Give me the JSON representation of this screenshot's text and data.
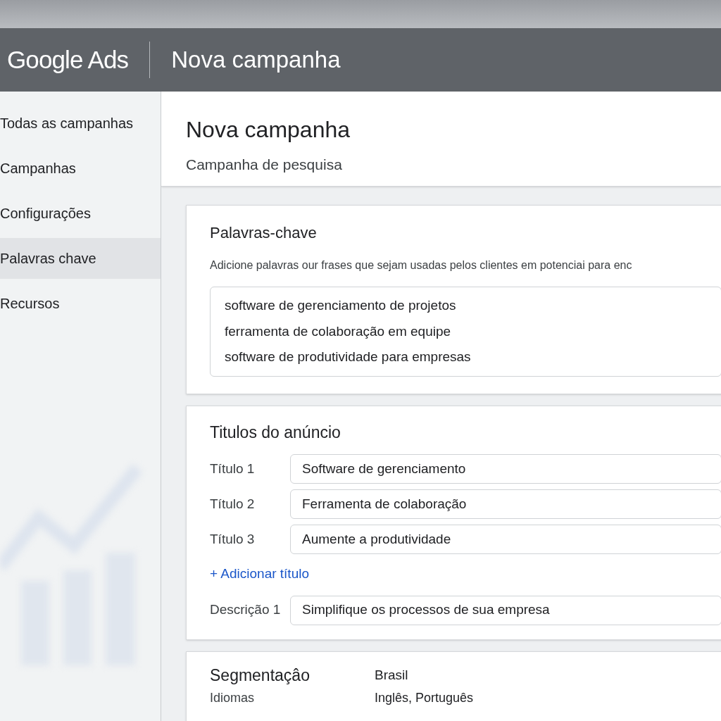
{
  "header": {
    "logo": "Google Ads",
    "title": "Nova campanha"
  },
  "sidebar": {
    "items": [
      {
        "label": "Todas as campanhas",
        "selected": false
      },
      {
        "label": "Campanhas",
        "selected": false
      },
      {
        "label": "Configurações",
        "selected": false
      },
      {
        "label": "Palavras chave",
        "selected": true
      },
      {
        "label": "Recursos",
        "selected": false
      }
    ]
  },
  "page": {
    "title": "Nova campanha",
    "subtitle": "Campanha de pesquisa"
  },
  "keywords": {
    "title": "Palavras-chave",
    "description": "Adicione palavras our frases que sejam usadas pelos clientes em potenciai para enc",
    "lines": [
      "software de gerenciamento de projetos",
      "ferramenta de colaboração em equipe",
      "software de produtividade para empresas"
    ]
  },
  "ad_titles": {
    "title": "Titulos do anúncio",
    "fields": [
      {
        "label": "Título 1",
        "value": "Software de gerenciamento"
      },
      {
        "label": "Título 2",
        "value": "Ferramenta de colaboração"
      },
      {
        "label": "Título 3",
        "value": "Aumente a produtividade"
      }
    ],
    "add_link": "+ Adicionar título",
    "description_field": {
      "label": "Descrição 1",
      "value": "Simplifique os processos de sua empresa"
    }
  },
  "targeting": {
    "title": "Segmentaçâo",
    "location": "Brasil",
    "languages_label": "Idiomas",
    "languages": "Inglês, Português"
  }
}
